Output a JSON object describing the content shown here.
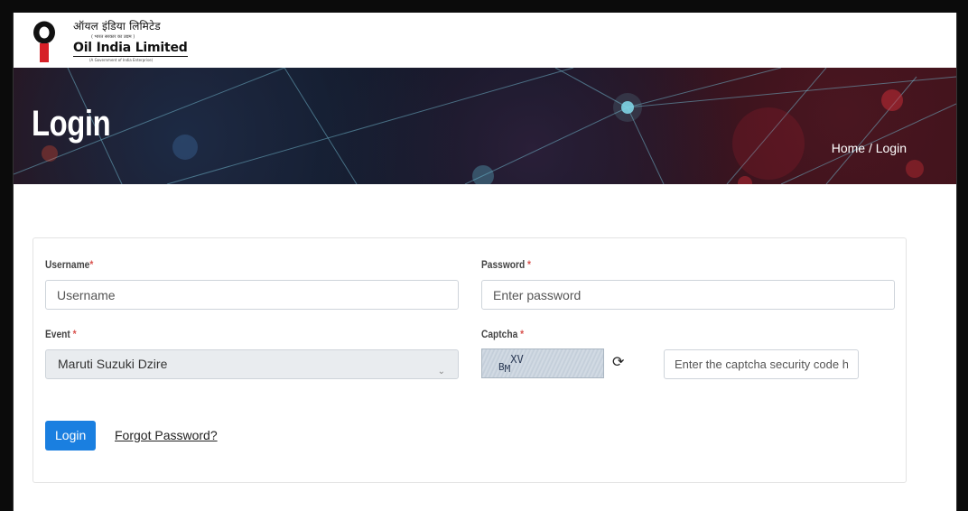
{
  "logo": {
    "hindi_name": "ऑयल इंडिया लिमिटेड",
    "hindi_sub": "( भारत सरकार का उद्यम )",
    "english_name": "Oil India Limited",
    "gov_line": "(A Government of India Enterprise)"
  },
  "banner": {
    "title": "Login",
    "breadcrumb": "Home / Login"
  },
  "form": {
    "username": {
      "label": "Username",
      "required_mark": "*",
      "placeholder": "Username",
      "value": ""
    },
    "password": {
      "label": "Password ",
      "required_mark": "*",
      "placeholder": "Enter password",
      "value": ""
    },
    "event": {
      "label": "Event ",
      "required_mark": "*",
      "selected": "Maruti Suzuki Dzire"
    },
    "captcha": {
      "label": "Captcha ",
      "required_mark": "*",
      "image_text": "BMXV",
      "placeholder": "Enter the captcha security code here.",
      "value": ""
    },
    "login_button": "Login",
    "forgot_link": "Forgot Password?"
  },
  "colors": {
    "primary": "#1a7fe0",
    "required": "#d9534f",
    "logo_red": "#d62027"
  }
}
